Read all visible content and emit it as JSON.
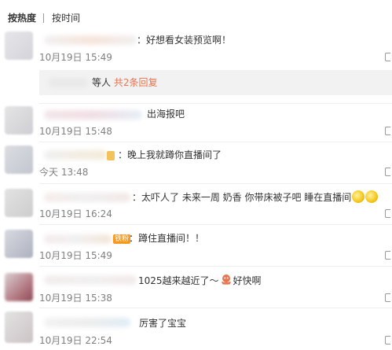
{
  "sort": {
    "hot": "按热度",
    "time": "按时间"
  },
  "comments": [
    {
      "text": "：好想看女装预览啊！",
      "time": "10月19日 15:49"
    },
    {
      "text": "出海报吧",
      "time": "10月19日 15:48"
    },
    {
      "text": "：晚上我就蹲你直播间了",
      "time": "今天 13:48"
    },
    {
      "text": "：太吓人了 未来一周 奶香 你带床被子吧 睡在直播间",
      "time": "10月19日 16:24"
    },
    {
      "text": "：蹲住直播间！！",
      "time": "10月19日 15:49"
    },
    {
      "text_before": "1025越来越近了～",
      "text_after": "好快啊",
      "time": "10月19日 15:38"
    },
    {
      "text": "厉害了宝宝",
      "time": "10月19日 22:54"
    }
  ],
  "reply_summary": {
    "prefix": "等人",
    "count_text": "共2条回复"
  },
  "badges": {
    "fan": "铁粉"
  },
  "icons": {
    "reply": "reply-icon",
    "emoji": "grin-emoji-icon",
    "octopus": "octopus-emoji-icon"
  },
  "colors": {
    "accent": "#eb7350",
    "time": "#808080"
  }
}
